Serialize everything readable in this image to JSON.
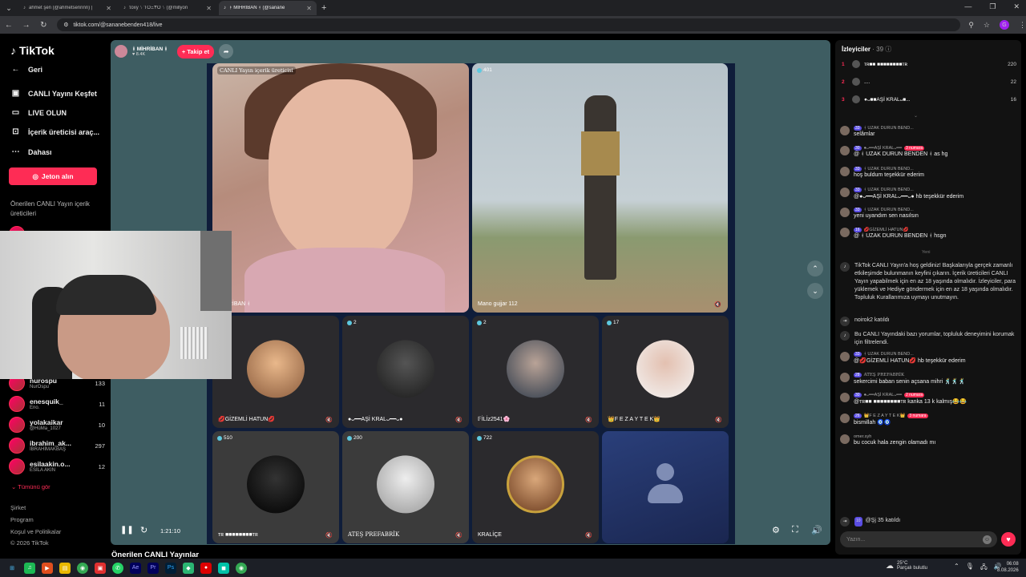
{
  "browser": {
    "tabs": [
      {
        "label": "ahmet şen (@ahmetsennnn) |",
        "active": false
      },
      {
        "label": "τoxy ᛊ ƬOΞɎO ᛊ (@millyon",
        "active": false
      },
      {
        "label": "ᚼ MİHRİBAN ᚼ (@sanane",
        "active": true
      }
    ],
    "url": "tiktok.com/@sananebenden418/live",
    "profile_letter": "G"
  },
  "sidebar": {
    "logo": "TikTok",
    "items": [
      {
        "icon": "←",
        "label": "Geri"
      },
      {
        "icon": "▣",
        "label": "CANLI Yayını Keşfet"
      },
      {
        "icon": "▭",
        "label": "LIVE OLUN"
      },
      {
        "icon": "⊡",
        "label": "İçerik üreticisi araç..."
      },
      {
        "icon": "⋯",
        "label": "Dahası"
      }
    ],
    "coins_button": "Jeton alın",
    "suggested_title": "Önerilen CANLI Yayın içerik üreticileri",
    "suggested": [
      {
        "name": "emelozeor",
        "sub": "",
        "count": ""
      },
      {
        "name": "nurospu",
        "sub": "NurOspu",
        "count": "133"
      },
      {
        "name": "enesquik_",
        "sub": "Eno.",
        "count": "11"
      },
      {
        "name": "yolakaikar",
        "sub": "@HüMa_1027",
        "count": "10"
      },
      {
        "name": "ibrahim_ak...",
        "sub": "İBRAHİMAKBAŞ",
        "count": "297"
      },
      {
        "name": "esilaakin.o...",
        "sub": "ESİLA AKIN",
        "count": "12"
      }
    ],
    "see_all": "Tümünü gör",
    "footer": [
      "Şirket",
      "Program",
      "Koşul ve Politikalar",
      "© 2026 TikTok"
    ]
  },
  "stream": {
    "host_name": "ᚼ MİHRİBAN ᚼ",
    "host_likes": "♥ 8.4K",
    "follow_label": "+ Takip et",
    "host_tag": "CANLI Yayın içerik üreticisi",
    "host_cell_label": "MİHRİBAN ᚼ",
    "guest_count": "401",
    "guest_label": "Mano gujjar 112",
    "cells": [
      {
        "count": "",
        "label": "💋GİZEMLİ HATUN💋"
      },
      {
        "count": "2",
        "label": "●ᴗ━━AŞİ KRALᴗ━━ᴗ●"
      },
      {
        "count": "2",
        "label": "𝔽İLİz2541🌸"
      },
      {
        "count": "17",
        "label": "👑F E Z A Y T E K👑"
      },
      {
        "count": "510",
        "label": "ᴛʀ ■■■■■■■■ᴛʀ"
      },
      {
        "count": "200",
        "label": "ATEŞ PREFABRİK"
      },
      {
        "count": "722",
        "label": "KRALİÇE"
      },
      {
        "count": "",
        "label": ""
      }
    ],
    "elapsed": "1:21:10",
    "below_title": "Önerilen CANLI Yayınlar"
  },
  "chat": {
    "viewers_title": "İzleyiciler",
    "viewers_count": "· 39",
    "top_viewers": [
      {
        "rank": "1",
        "name": "ᴛʀ■■ ■■■■■■■■ᴛʀ",
        "value": "220"
      },
      {
        "rank": "2",
        "name": "....",
        "value": "22"
      },
      {
        "rank": "3",
        "name": "●ᴗ■■AŞİ KRALᴗ■...",
        "value": "16"
      }
    ],
    "messages": [
      {
        "lvl": "33",
        "user": "ᚼ UZAK DURUN BEND...",
        "rank": "",
        "text": "selâmlar"
      },
      {
        "lvl": "30",
        "user": "●ᴗ━━AŞİ KRALᴗ━━",
        "rank": "3 numara",
        "text": "@ ᚼ UZAK DURUN BENDEN ᚼ  as hg"
      },
      {
        "lvl": "33",
        "user": "ᚼ UZAK DURUN BEND...",
        "rank": "",
        "text": "hoş buldum teşekkür ederim"
      },
      {
        "lvl": "33",
        "user": "ᚼ UZAK DURUN BEND...",
        "rank": "",
        "text": "@●ᴗ━━AŞİ KRALᴗ━━ᴗ● hb teşekkür ederim"
      },
      {
        "lvl": "33",
        "user": "ᚼ UZAK DURUN BEND...",
        "rank": "",
        "text": "yeni uyandım sen nasılsın"
      },
      {
        "lvl": "16",
        "user": "💋GİZEMLİ HATUN💋",
        "rank": "",
        "text": "@ ᚼ UZAK DURUN BENDEN ᚼ  hsgn"
      }
    ],
    "new_label": "Yeni",
    "system_msg": "TikTok CANLI Yayın'a hoş geldiniz! Başkalarıyla gerçek zamanlı etkileşimde bulunmanın keyfini çıkarın. İçerik üreticileri CANLI Yayın yapabilmek için en az 18 yaşında olmalıdır. İzleyiciler, para yüklemek ve Hediye göndermek için en az 18 yaşında olmalıdır. Topluluk Kurallarımıza uymayı unutmayın.",
    "joined1": "noirok2  katıldı",
    "filter_msg": "Bu CANLI Yayındaki bazı yorumlar, topluluk deneyimini korumak için filtrelendi.",
    "messages2": [
      {
        "lvl": "33",
        "user": "ᚼ UZAK DURUN BEND...",
        "rank": "",
        "text": "@💋GİZEMLİ HATUN💋 hb teşekkür ederim"
      },
      {
        "lvl": "28",
        "user": "ATEŞ PREFABRİK",
        "rank": "",
        "text": "sekercimi baban senin açsana mihri 🕺🕺🕺"
      },
      {
        "lvl": "30",
        "user": "●ᴗ━━AŞİ KRALᴗ━━",
        "rank": "2 numara",
        "text": "@ᴛʀ■■ ■■■■■■■■ᴛʀ kanka 13 k kalmış😂😂"
      },
      {
        "lvl": "26",
        "user": "👑F E Z A Y T E K👑",
        "rank": "3 numara",
        "text": "bismillah 🧿🧿"
      },
      {
        "lvl": "",
        "user": "omer.syh",
        "rank": "",
        "text": "bu cocuk hala zengin olamadı mı"
      }
    ],
    "joined2": "@Şj 35  katıldı",
    "joined2_lvl": "10",
    "input_placeholder": "Yazın..."
  },
  "taskbar": {
    "weather_temp": "25°C",
    "weather_desc": "Parçalı bulutlu",
    "time": "06:08",
    "date": "8.08.2026"
  }
}
